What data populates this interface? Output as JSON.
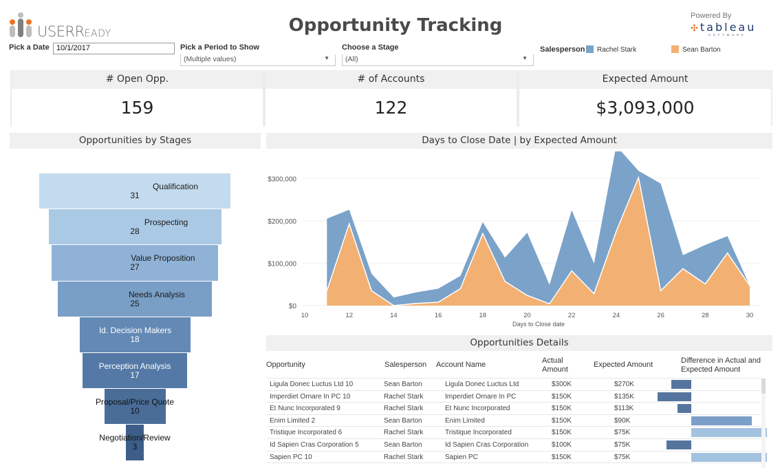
{
  "header": {
    "logo_text": "USER",
    "logo_text_small": "EADY",
    "logo_text_r": "R",
    "title": "Opportunity Tracking",
    "powered_by": "Powered By",
    "tableau_text": "tableau",
    "tableau_sub": "SOFTWARE"
  },
  "filters": {
    "date_label": "Pick a Date",
    "date_value": "10/1/2017",
    "period_label": "Pick a Period to Show",
    "period_value": "(Multiple values)",
    "stage_label": "Choose a Stage",
    "stage_value": "(All)",
    "dropdown_arrow": "▼"
  },
  "legend": {
    "title": "Salesperson",
    "items": [
      {
        "name": "Rachel Stark",
        "color": "#7ba3c9"
      },
      {
        "name": "Sean Barton",
        "color": "#f2b073"
      }
    ]
  },
  "kpis": [
    {
      "label": "# Open Opp.",
      "value": "159"
    },
    {
      "label": "# of Accounts",
      "value": "122"
    },
    {
      "label": "Expected Amount",
      "value": "$3,093,000"
    }
  ],
  "funnel": {
    "title": "Opportunities by Stages",
    "stages": [
      {
        "name": "Qualification",
        "count": "31",
        "color": "#c3dbee",
        "text": "#1a1a1a"
      },
      {
        "name": "Prospecting",
        "count": "28",
        "color": "#aac9e4",
        "text": "#1a1a1a"
      },
      {
        "name": "Value Proposition",
        "count": "27",
        "color": "#8fb2d6",
        "text": "#1a1a1a"
      },
      {
        "name": "Needs Analysis",
        "count": "25",
        "color": "#7a9fc6",
        "text": "#1a1a1a"
      },
      {
        "name": "Id. Decision Makers",
        "count": "18",
        "color": "#6389b5",
        "text": "#ffffff"
      },
      {
        "name": "Perception Analysis",
        "count": "17",
        "color": "#5479a6",
        "text": "#ffffff"
      },
      {
        "name": "Proposal/Price Quote",
        "count": "10",
        "color": "#4a6d98",
        "text": "#111111"
      },
      {
        "name": "Negotiation/Review",
        "count": "3",
        "color": "#3d5e88",
        "text": "#111111"
      }
    ]
  },
  "chart_data": {
    "type": "area",
    "title": "Days to Close Date | by Expected Amount",
    "xlabel": "Days to Close date",
    "ylabel": "",
    "stacked": true,
    "x": [
      11,
      12,
      13,
      14,
      15,
      16,
      17,
      18,
      19,
      20,
      21,
      22,
      23,
      24,
      25,
      26,
      27,
      28,
      29,
      30
    ],
    "series": [
      {
        "name": "Sean Barton",
        "color": "#f2b073",
        "values": [
          35000,
          193000,
          35000,
          0,
          5000,
          8000,
          40000,
          170000,
          57000,
          24000,
          4000,
          82000,
          28000,
          175000,
          302000,
          35000,
          87000,
          51000,
          124000,
          47000
        ]
      },
      {
        "name": "Rachel Stark",
        "color": "#7ba3c9",
        "values": [
          170000,
          33000,
          40000,
          19000,
          26000,
          32000,
          30000,
          27000,
          56000,
          148000,
          45000,
          143000,
          71000,
          202000,
          16000,
          253000,
          32000,
          92000,
          40000,
          0
        ]
      }
    ],
    "xticks": [
      "10",
      "12",
      "14",
      "16",
      "18",
      "20",
      "22",
      "24",
      "26",
      "28",
      "30"
    ],
    "xlim": [
      10,
      30
    ],
    "yticks": [
      "$0",
      "$100,000",
      "$200,000",
      "$300,000"
    ],
    "ylim": [
      0,
      380000
    ],
    "grid": true
  },
  "details": {
    "title": "Opportunities Details",
    "columns": [
      "Opportunity",
      "Salesperson",
      "Account Name",
      "Actual Amount",
      "Expected Amount",
      "Difference in Actual and Expected Amount"
    ],
    "rows": [
      {
        "opportunity": "Ligula Donec Luctus Ltd 10",
        "salesperson": "Sean Barton",
        "account": "Ligula Donec Luctus Ltd",
        "actual": "$300K",
        "expected": "$270K",
        "diff": -30000
      },
      {
        "opportunity": "Imperdiet Ornare In PC 10",
        "salesperson": "Rachel Stark",
        "account": "Imperdiet Ornare In PC",
        "actual": "$150K",
        "expected": "$135K",
        "diff": -50000
      },
      {
        "opportunity": "Et Nunc Incorporated 9",
        "salesperson": "Rachel Stark",
        "account": "Et Nunc Incorporated",
        "actual": "$150K",
        "expected": "$113K",
        "diff": -20000
      },
      {
        "opportunity": "Enim Limited 2",
        "salesperson": "Sean Barton",
        "account": "Enim Limited",
        "actual": "$150K",
        "expected": "$90K",
        "diff": 90000
      },
      {
        "opportunity": "Tristique Incorporated 6",
        "salesperson": "Rachel Stark",
        "account": "Tristique Incorporated",
        "actual": "$150K",
        "expected": "$75K",
        "diff": 112000
      },
      {
        "opportunity": "Id Sapien Cras Corporation 5",
        "salesperson": "Sean Barton",
        "account": "Id Sapien Cras Corporation",
        "actual": "$100K",
        "expected": "$75K",
        "diff": -37000
      },
      {
        "opportunity": "Sapien PC 10",
        "salesperson": "Rachel Stark",
        "account": "Sapien PC",
        "actual": "$150K",
        "expected": "$75K",
        "diff": 112000
      }
    ]
  }
}
